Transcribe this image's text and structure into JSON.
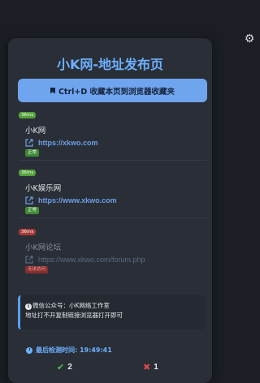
{
  "page": {
    "title": "小K网-地址发布页",
    "bookmark_button": "Ctrl+D 收藏本页到浏览器收藏夹"
  },
  "sites": [
    {
      "latency": "36ms",
      "name": "小K网",
      "url": "https://xkwo.com",
      "status": "正常",
      "ok": true
    },
    {
      "latency": "36ms",
      "name": "小K娱乐网",
      "url": "https://www.xkwo.com",
      "status": "正常",
      "ok": true
    },
    {
      "latency": "36ms",
      "name": "小K网论坛",
      "url": "https://www.xkwo.com/forum.php",
      "status": "无法访问",
      "ok": false
    }
  ],
  "notice": {
    "line1": "微信公众号：小K网络工作室",
    "line2": "地址打不开复制链接浏览器打开即可"
  },
  "last_check": "最后检测时间: 19:49:41",
  "stats": {
    "ok_count": "2",
    "fail_count": "1"
  },
  "colors": {
    "accent": "#6eb0ff",
    "button": "#6fa4ee",
    "ok": "#3e8a34",
    "fail": "#8a2e2e"
  },
  "icons": [
    "gear-icon",
    "bookmark-icon",
    "link-icon",
    "info-icon",
    "clock-icon",
    "check-icon",
    "x-icon"
  ]
}
